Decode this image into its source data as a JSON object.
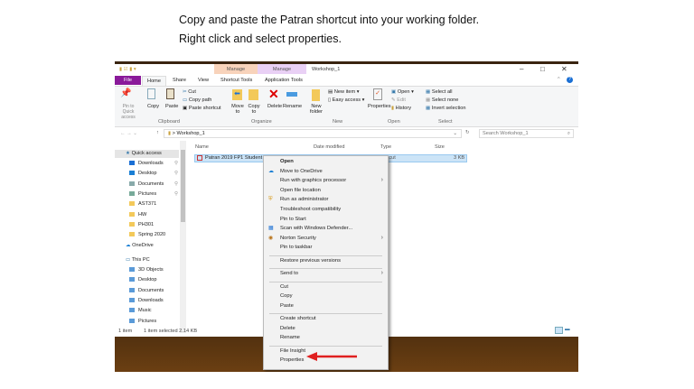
{
  "caption": {
    "line1": "Copy and paste the Patran shortcut into your working folder.",
    "line2": "Right click and select properties."
  },
  "window": {
    "title": "Workshop_1",
    "controls": [
      "minimize",
      "maximize",
      "close"
    ]
  },
  "ribbon": {
    "context_tabs": [
      {
        "label": "Manage",
        "sub": "Shortcut Tools",
        "color": "#f8d3bb"
      },
      {
        "label": "Manage",
        "sub": "Application Tools",
        "color": "#e9d0f5"
      }
    ],
    "tabs": [
      "File",
      "Home",
      "Share",
      "View"
    ],
    "groups": {
      "clipboard": {
        "label": "Clipboard",
        "pin": "Pin to Quick access",
        "copy": "Copy",
        "paste": "Paste",
        "cut": "Cut",
        "copy_path": "Copy path",
        "paste_shortcut": "Paste shortcut"
      },
      "organize": {
        "label": "Organize",
        "move_to": "Move to",
        "copy_to": "Copy to",
        "delete": "Delete",
        "rename": "Rename"
      },
      "new": {
        "label": "New",
        "new_folder": "New folder",
        "new_item": "New item",
        "easy_access": "Easy access"
      },
      "open": {
        "label": "Open",
        "properties": "Properties",
        "open": "Open",
        "edit": "Edit",
        "history": "History"
      },
      "select": {
        "label": "Select",
        "select_all": "Select all",
        "select_none": "Select none",
        "invert": "Invert selection"
      }
    }
  },
  "address": {
    "path": "Workshop_1",
    "search_placeholder": "Search Workshop_1"
  },
  "columns": [
    "Name",
    "Date modified",
    "Type",
    "Size"
  ],
  "file": {
    "name": "Patran 2019 FP1 Student",
    "type": "Shortcut",
    "size": "3 KB"
  },
  "sidebar": {
    "quick_access": "Quick access",
    "items": [
      "Downloads",
      "Desktop",
      "Documents",
      "Pictures",
      "AST371",
      "HW",
      "PH301",
      "Spring 2020"
    ],
    "onedrive": "OneDrive",
    "this_pc": "This PC",
    "pc_items": [
      "3D Objects",
      "Desktop",
      "Documents",
      "Downloads",
      "Music",
      "Pictures"
    ]
  },
  "status": {
    "count": "1 item",
    "selected": "1 item selected  2.14 KB"
  },
  "context_menu": [
    "Open",
    "Move to OneDrive",
    "Run with graphics processor",
    "Open file location",
    "Run as administrator",
    "Troubleshoot compatibility",
    "Pin to Start",
    "Scan with Windows Defender...",
    "Norton Security",
    "Pin to taskbar",
    "Restore previous versions",
    "Send to",
    "Cut",
    "Copy",
    "Paste",
    "Create shortcut",
    "Delete",
    "Rename",
    "File Insight",
    "Properties"
  ],
  "arrow_color": "#e02020"
}
